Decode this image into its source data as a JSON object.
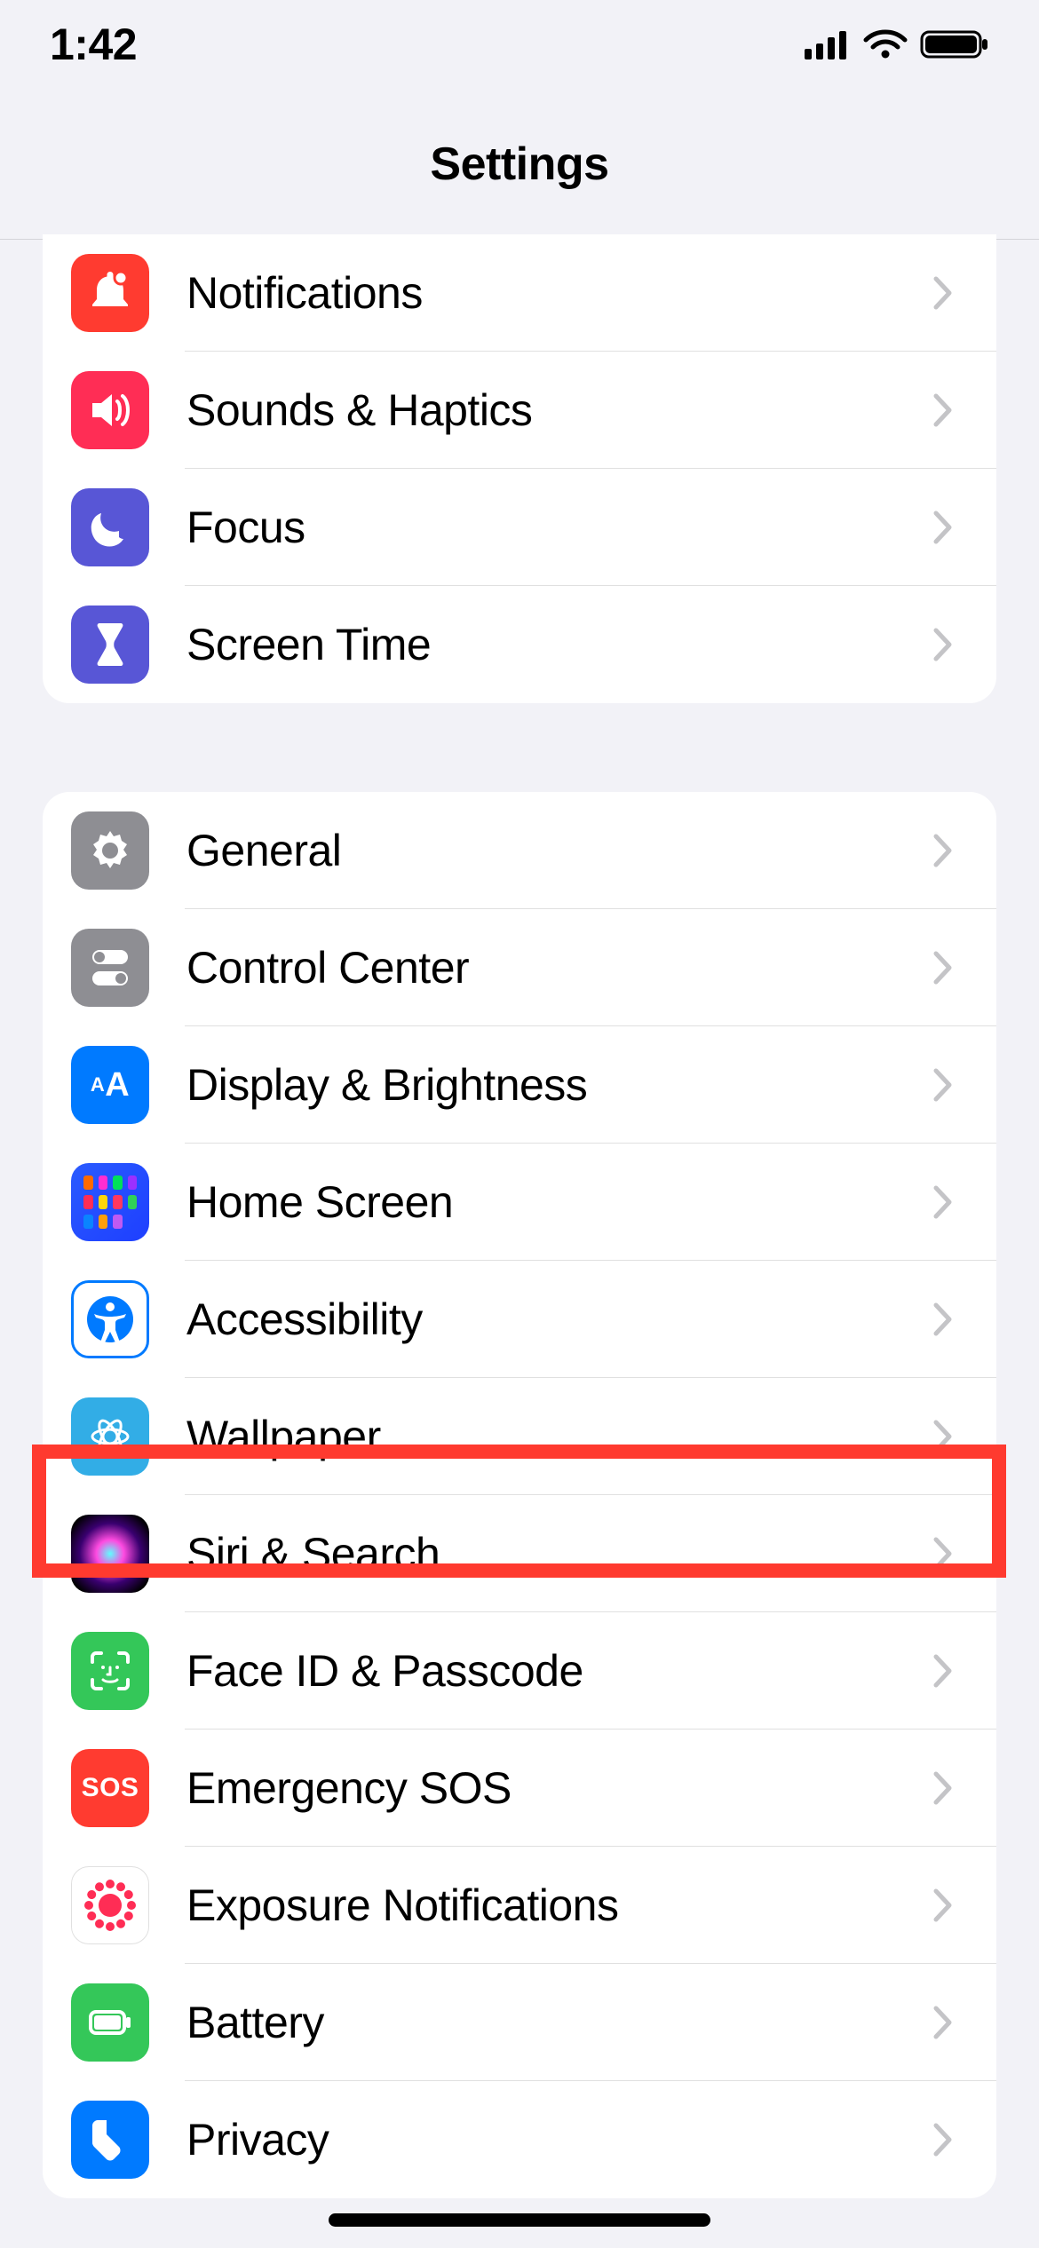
{
  "status": {
    "time": "1:42"
  },
  "header": {
    "title": "Settings"
  },
  "group1": [
    {
      "label": "Notifications"
    },
    {
      "label": "Sounds & Haptics"
    },
    {
      "label": "Focus"
    },
    {
      "label": "Screen Time"
    }
  ],
  "group2": [
    {
      "label": "General"
    },
    {
      "label": "Control Center"
    },
    {
      "label": "Display & Brightness"
    },
    {
      "label": "Home Screen"
    },
    {
      "label": "Accessibility"
    },
    {
      "label": "Wallpaper"
    },
    {
      "label": "Siri & Search"
    },
    {
      "label": "Face ID & Passcode"
    },
    {
      "label": "Emergency SOS"
    },
    {
      "label": "Exposure Notifications"
    },
    {
      "label": "Battery"
    },
    {
      "label": "Privacy"
    }
  ],
  "highlighted_label": "Siri & Search",
  "sos_text": "SOS",
  "aa_text": "AA"
}
